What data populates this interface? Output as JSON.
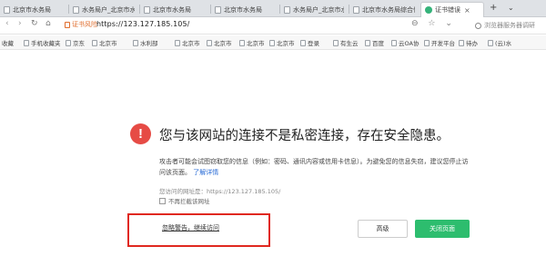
{
  "tabs": [
    {
      "label": "北京市水务局",
      "active": false
    },
    {
      "label": "水务局户_北京市水务...",
      "active": false
    },
    {
      "label": "北京市水务局",
      "active": false
    },
    {
      "label": "北京市水务局",
      "active": false
    },
    {
      "label": "水务局户_北京市水务局",
      "active": false
    },
    {
      "label": "北京市水务局综合信息",
      "active": false
    },
    {
      "label": "证书错误",
      "active": true
    }
  ],
  "new_tab": "+",
  "address": {
    "risk_label": "证书风险",
    "url": "https://123.127.185.105/",
    "search_placeholder": "浏览器服务器调研"
  },
  "bookmarks": [
    "收藏",
    "手机收藏夹",
    "京东",
    "北京市",
    "水利部",
    "北京市",
    "北京市",
    "北京市",
    "北京市",
    "登录",
    "有生云",
    "百度",
    "云OA协",
    "开发平台",
    "待办",
    "(云)水"
  ],
  "error": {
    "headline": "您与该网站的连接不是私密连接，存在安全隐患。",
    "description": "攻击者可能会试图窃取您的信息（例如：密码、通讯内容或信用卡信息）。为避免您的信息失窃，建议您停止访问该页面。",
    "learn_more": "了解详情",
    "visited_url": "您访问的网址是：https://123.127.185.105/",
    "no_warn_label": "不再拦截该网址",
    "ignore_link": "忽略警告，继续访问",
    "advanced_button": "高级",
    "close_button": "关闭页面"
  },
  "colors": {
    "error_red": "#e64b45",
    "close_green": "#2dbd6e",
    "highlight_red": "#e0281f",
    "link_blue": "#2a6cd6",
    "risk_orange": "#e06c2c"
  }
}
